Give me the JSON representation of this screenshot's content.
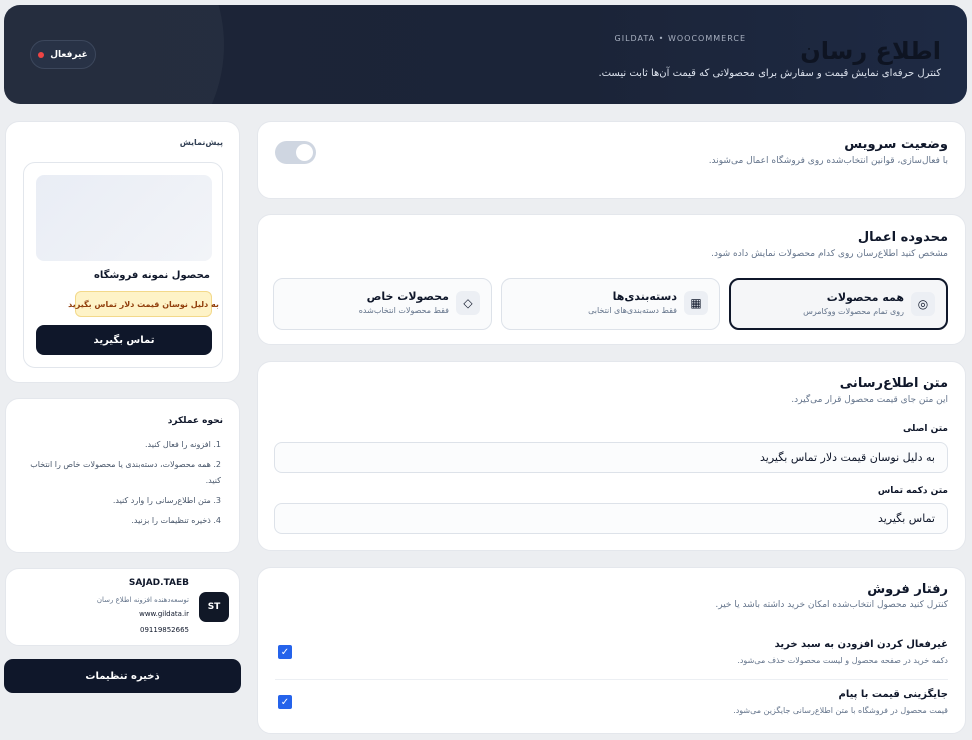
{
  "header": {
    "brand": "GILDATA • WOOCOMMERCE",
    "title": "اطلاع رسان",
    "subtitle": "کنترل حرفه‌ای نمایش قیمت و سفارش برای محصولاتی که قیمت آن‌ها ثابت نیست.",
    "status_label": "غیرفعال",
    "status_color": "#ef4444"
  },
  "service": {
    "title": "وضعیت سرویس",
    "desc": "با فعال‌سازی، قوانین انتخاب‌شده روی فروشگاه اعمال می‌شوند."
  },
  "scope": {
    "title": "محدوده اعمال",
    "desc": "مشخص کنید اطلاع‌رسان روی کدام محصولات نمایش داده شود.",
    "options": [
      {
        "label": "همه محصولات",
        "hint": "روی تمام محصولات ووکامرس",
        "icon": "◎"
      },
      {
        "label": "دسته‌بندی‌ها",
        "hint": "فقط دسته‌بندی‌های انتخابی",
        "icon": "▦"
      },
      {
        "label": "محصولات خاص",
        "hint": "فقط محصولات انتخاب‌شده",
        "icon": "◇"
      }
    ]
  },
  "notify": {
    "title": "متن اطلاع‌رسانی",
    "desc": "این متن جای قیمت محصول قرار می‌گیرد.",
    "main_label": "متن اصلی",
    "main_value": "به دلیل نوسان قیمت دلار تماس بگیرید",
    "button_label": "متن دکمه تماس",
    "button_value": "تماس بگیرید"
  },
  "sales": {
    "title": "رفتار فروش",
    "desc": "کنترل کنید محصول انتخاب‌شده امکان خرید داشته باشد یا خیر.",
    "rows": [
      {
        "title": "غیرفعال کردن افزودن به سبد خرید",
        "desc": "دکمه خرید در صفحه محصول و لیست محصولات حذف می‌شود."
      },
      {
        "title": "جایگزینی قیمت با پیام",
        "desc": "قیمت محصول در فروشگاه با متن اطلاع‌رسانی جایگزین می‌شود."
      }
    ],
    "check_glyph": "✓"
  },
  "preview": {
    "title": "پیش‌نمایش",
    "product_name": "محصول نمونه فروشگاه",
    "badge": "به دلیل نوسان قیمت دلار تماس بگیرید",
    "button": "تماس بگیرید"
  },
  "how": {
    "title": "نحوه عملکرد",
    "steps": [
      "1. افزونه را فعال کنید.",
      "2. همه محصولات، دسته‌بندی یا محصولات خاص را انتخاب کنید.",
      "3. متن اطلاع‌رسانی را وارد کنید.",
      "4. ذخیره تنظیمات را بزنید."
    ]
  },
  "profile": {
    "initials": "ST",
    "name": "SAJAD.TAEB",
    "role": "توسعه‌دهنده افزونه اطلاع رسان",
    "website": "www.gildata.ir",
    "phone": "09119852665"
  },
  "save_label": "ذخیره تنظیمات"
}
